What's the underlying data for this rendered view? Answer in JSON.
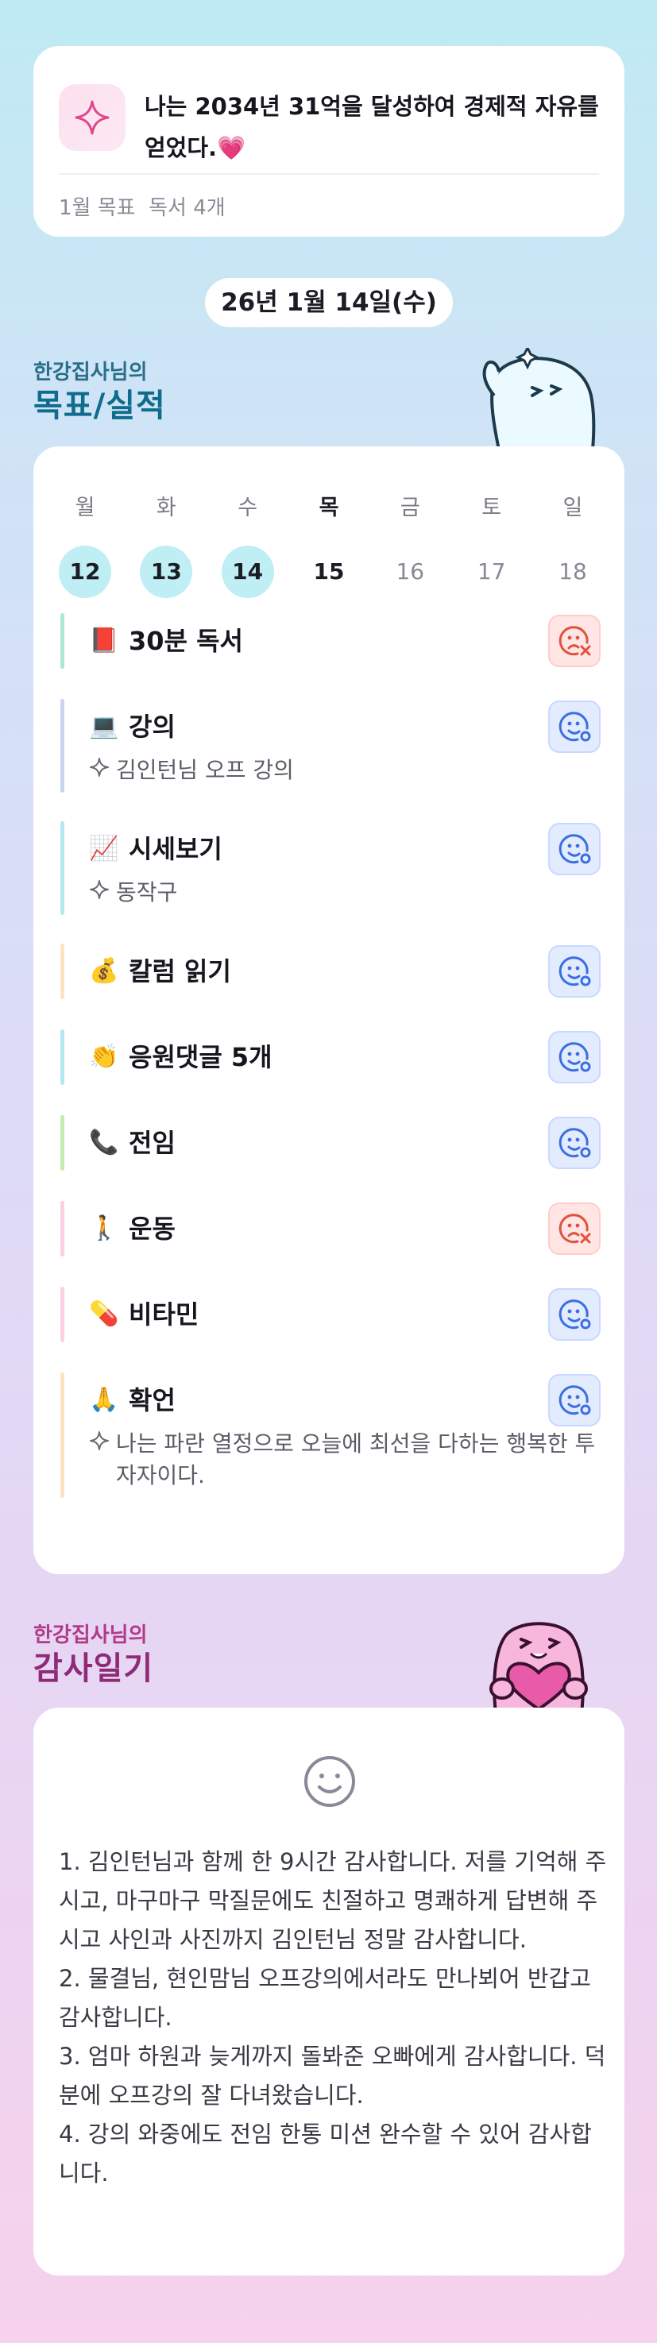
{
  "goal": {
    "statement": "나는 2034년 31억을 달성하여 경제적 자유를 얻었다.",
    "heart": "💗",
    "monthly_goal": "1월 목표  독서 4개"
  },
  "date_label": "26년 1월 14일(수)",
  "goals_section": {
    "small": "한강집사님의",
    "big": "목표/실적"
  },
  "week": [
    {
      "day": "월",
      "num": "12",
      "state": "done"
    },
    {
      "day": "화",
      "num": "13",
      "state": "done"
    },
    {
      "day": "수",
      "num": "14",
      "state": "done"
    },
    {
      "day": "목",
      "num": "15",
      "state": "today"
    },
    {
      "day": "금",
      "num": "16",
      "state": "future"
    },
    {
      "day": "토",
      "num": "17",
      "state": "future"
    },
    {
      "day": "일",
      "num": "18",
      "state": "future"
    }
  ],
  "habits": [
    {
      "emoji": "📕",
      "title": "30분 독서",
      "note": "",
      "status": "fail",
      "bar": "#aee6d4"
    },
    {
      "emoji": "💻",
      "title": "강의",
      "note": "김인턴님 오프 강의",
      "status": "ok",
      "bar": "#c9d4ee"
    },
    {
      "emoji": "📈",
      "title": "시세보기",
      "note": "동작구",
      "status": "ok",
      "bar": "#b6e6f2"
    },
    {
      "emoji": "💰",
      "title": "칼럼 읽기",
      "note": "",
      "status": "ok",
      "bar": "#fde3c4"
    },
    {
      "emoji": "👏",
      "title": "응원댓글 5개",
      "note": "",
      "status": "ok",
      "bar": "#b6e6f2"
    },
    {
      "emoji": "📞",
      "title": "전임",
      "note": "",
      "status": "ok",
      "bar": "#c4ecae"
    },
    {
      "emoji": "🚶",
      "title": "운동",
      "note": "",
      "status": "fail",
      "bar": "#fbd0e4"
    },
    {
      "emoji": "💊",
      "title": "비타민",
      "note": "",
      "status": "ok",
      "bar": "#fbd0e4"
    },
    {
      "emoji": "🙏",
      "title": "확언",
      "note": "나는 파란 열정으로 오늘에 최선을 다하는 행복한 투자자이다.",
      "status": "ok",
      "bar": "#fde3c4"
    }
  ],
  "diary_section": {
    "small": "한강집사님의",
    "big": "감사일기"
  },
  "diary": {
    "entries": [
      "1. 김인턴님과 함께 한 9시간 감사합니다. 저를 기억해 주시고, 마구마구 막질문에도 친절하고 명쾌하게 답변해 주시고 사인과 사진까지 김인턴님 정말 감사합니다.",
      "2. 물결님, 현인맘님 오프강의에서라도 만나뵈어 반갑고 감사합니다.",
      "3. 엄마 하원과 늦게까지 돌봐준 오빠에게 감사합니다. 덕분에 오프강의 잘 다녀왔습니다.",
      "4. 강의 와중에도 전임 한통 미션 완수할 수 있어 감사합니다."
    ]
  },
  "colors": {
    "ok_icon": "#3b6fe0",
    "fail_icon": "#e0523f",
    "done_day": "#bfeef4"
  }
}
